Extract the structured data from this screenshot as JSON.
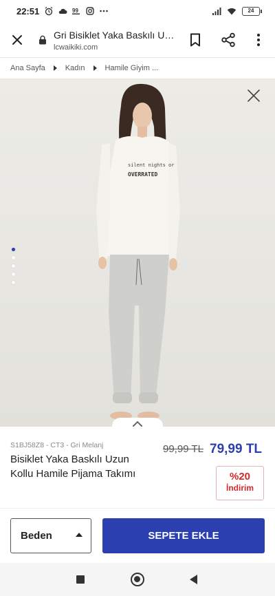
{
  "status_bar": {
    "time": "22:51",
    "battery": "24",
    "left_icons": [
      "alarm-icon",
      "cloud-icon",
      "app-badge-icon",
      "instagram-icon",
      "more-dots-icon"
    ],
    "right_icons": [
      "signal-icon",
      "wifi-icon",
      "battery-icon"
    ]
  },
  "browser": {
    "title": "Gri Bisiklet Yaka Baskılı Uzun Kollu Hamile Pijama Takımı",
    "domain": "lcwaikiki.com",
    "icons": [
      "close-icon",
      "lock-icon",
      "bookmark-icon",
      "share-icon",
      "menu-dots-icon"
    ]
  },
  "breadcrumb": {
    "items": [
      "Ana Sayfa",
      "Kadın",
      "Hamile Giyim ..."
    ]
  },
  "gallery": {
    "image_alt": "Model wearing light pajama set with printed top",
    "shirt_print_line1": "silent nights or",
    "shirt_print_line2": "OVERRATED",
    "dot_count": 5,
    "active_dot": 0
  },
  "product": {
    "sku": "S1BJ58Z8 - CT3 - Gri Melanj",
    "title": "Bisiklet Yaka Baskılı Uzun Kollu Hamile Pijama Takımı",
    "old_price": "99,99 TL",
    "new_price": "79,99 TL",
    "discount_percent": "%20",
    "discount_label": "İndirim"
  },
  "actions": {
    "size_label": "Beden",
    "add_to_cart": "SEPETE EKLE"
  },
  "colors": {
    "accent": "#2b3fb0",
    "discount": "#d7262a"
  }
}
